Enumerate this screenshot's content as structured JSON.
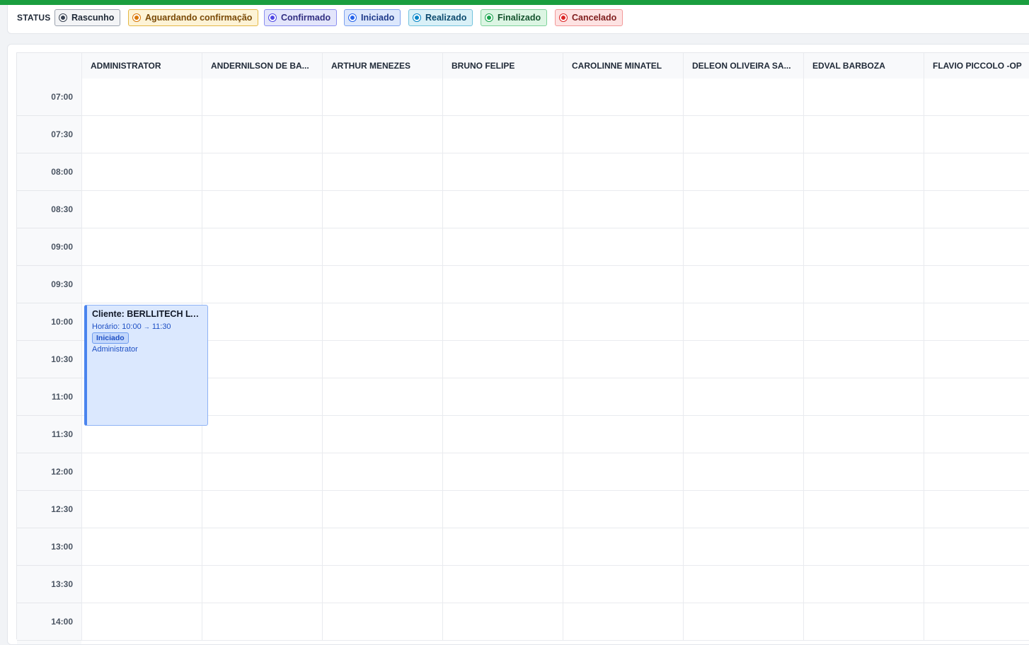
{
  "status_bar": {
    "label": "STATUS",
    "chips": [
      {
        "label": "Rascunho",
        "bg": "#f3f4f6",
        "border": "#9ca3af",
        "dot": "#374151",
        "text": "#1f2937"
      },
      {
        "label": "Aguardando confirmação",
        "bg": "#fdf3d6",
        "border": "#e5b845",
        "dot": "#d97706",
        "text": "#7a4a06"
      },
      {
        "label": "Confirmado",
        "bg": "#e3e5fb",
        "border": "#8b8ff0",
        "dot": "#4f46e5",
        "text": "#312e81"
      },
      {
        "label": "Iniciado",
        "bg": "#dce7fc",
        "border": "#7ea3ef",
        "dot": "#2563eb",
        "text": "#1e3a8a"
      },
      {
        "label": "Realizado",
        "bg": "#d9f0f7",
        "border": "#73c3dd",
        "dot": "#0284c7",
        "text": "#0c4a6e"
      },
      {
        "label": "Finalizado",
        "bg": "#dcf5e3",
        "border": "#7fd39a",
        "dot": "#16a34a",
        "text": "#14532d"
      },
      {
        "label": "Cancelado",
        "bg": "#fde2e2",
        "border": "#f29a9a",
        "dot": "#dc2626",
        "text": "#7f1d1d"
      }
    ]
  },
  "calendar": {
    "columns": [
      "ADMINISTRATOR",
      "ANDERNILSON DE BA...",
      "ARTHUR MENEZES",
      "BRUNO FELIPE",
      "CAROLINNE MINATEL",
      "DELEON OLIVEIRA SA...",
      "EDVAL BARBOZA",
      "FLAVIO PICCOLO -OP"
    ],
    "times": [
      "07:00",
      "07:30",
      "08:00",
      "08:30",
      "09:00",
      "09:30",
      "10:00",
      "10:30",
      "11:00",
      "11:30",
      "12:00",
      "12:30",
      "13:00",
      "13:30",
      "14:00"
    ],
    "event": {
      "title": "Cliente: BERLLITECH LT...",
      "time_label": "Horário:",
      "start": "10:00",
      "arrow": "→",
      "end": "11:30",
      "status": "Iniciado",
      "owner": "Administrator"
    }
  }
}
